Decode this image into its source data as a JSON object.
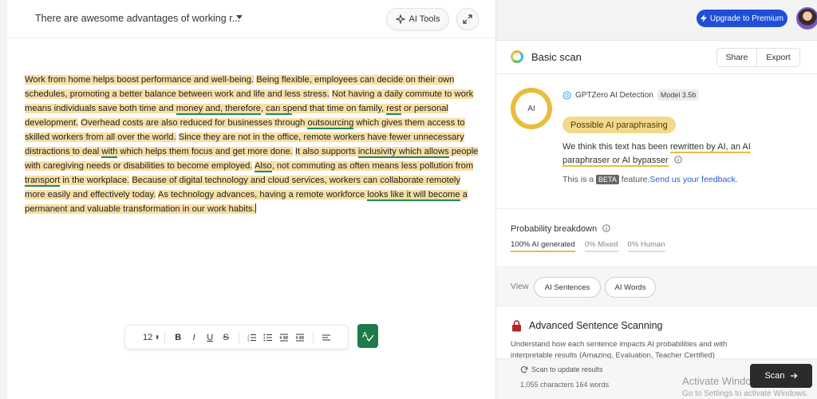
{
  "editor": {
    "doc_title": "There are awesome advantages of working r...",
    "ai_tools_label": "AI Tools",
    "paragraph": [
      {
        "t": "Work from home helps boost performance and well-being.",
        "hl": true
      },
      {
        "t": " ",
        "hl": false
      },
      {
        "t": "Being flexible, employees can decide on their own schedules, promoting a better balance between work and life and less stress.",
        "hl": true
      },
      {
        "t": " ",
        "hl": false
      },
      {
        "t": "Not having a daily commute to work means individuals save both time and ",
        "hl": true
      },
      {
        "t": "money and, therefore",
        "hl": true,
        "ul": true
      },
      {
        "t": ", ",
        "hl": true
      },
      {
        "t": "can sp",
        "hl": true,
        "ul": true
      },
      {
        "t": "end that time on family, ",
        "hl": true
      },
      {
        "t": "rest",
        "hl": true,
        "ul": true
      },
      {
        "t": " or personal development.",
        "hl": true
      },
      {
        "t": " ",
        "hl": false
      },
      {
        "t": "Overhead costs are also reduced for businesses through ",
        "hl": true
      },
      {
        "t": "outsourcing",
        "hl": true,
        "ul": true
      },
      {
        "t": " which gives them access to skilled workers from all over the world.",
        "hl": true
      },
      {
        "t": " ",
        "hl": false
      },
      {
        "t": "Since they are not in the office, remote workers have fewer unnecessary distractions to deal ",
        "hl": true
      },
      {
        "t": "with",
        "hl": true,
        "ul": true
      },
      {
        "t": " which helps them focus and get more done.",
        "hl": true
      },
      {
        "t": " ",
        "hl": false
      },
      {
        "t": "It also supports ",
        "hl": true
      },
      {
        "t": "inclusivity which allows",
        "hl": true,
        "ul": true
      },
      {
        "t": " people with caregiving needs or disabilities to become employed.",
        "hl": true
      },
      {
        "t": " ",
        "hl": false
      },
      {
        "t": "Also",
        "hl": true,
        "ul": true
      },
      {
        "t": ", not commuting as often means less pollution from ",
        "hl": true
      },
      {
        "t": "transport",
        "hl": true,
        "ul": true
      },
      {
        "t": " in the workplace.",
        "hl": true
      },
      {
        "t": " ",
        "hl": false
      },
      {
        "t": "Because of digital technology and cloud services, workers can collaborate remotely more easily and effectively today.",
        "hl": true
      },
      {
        "t": " ",
        "hl": false
      },
      {
        "t": "As technology advances, having a remote workforce ",
        "hl": true
      },
      {
        "t": "looks like it will become",
        "hl": true,
        "ul": true
      },
      {
        "t": " a permanent and valuable transformation in our work habits.",
        "hl": true
      }
    ],
    "toolbar": {
      "font_size": "12",
      "bold": "B",
      "italic": "I",
      "underline": "U",
      "strike": "S"
    }
  },
  "header": {
    "premium_label": "Upgrade to Premium"
  },
  "scan": {
    "title": "Basic scan",
    "share_label": "Share",
    "export_label": "Export",
    "ring_label": "AI",
    "detector": "GPTZero AI Detection",
    "model": "Model 3.5b",
    "verdict": "Possible AI paraphrasing",
    "explain_prefix": "We think this text has been ",
    "explain_highlight": "rewritten by AI, an AI paraphraser or AI bypasser",
    "beta_prefix": "This is a ",
    "beta_badge": "BETA",
    "beta_suffix": " feature.",
    "feedback_link": "Send us your feedback.",
    "prob_title": "Probability breakdown",
    "prob_tabs": [
      "100% AI generated",
      "0% Mixed",
      "0% Human"
    ],
    "view_label": "View",
    "view_sentences": "AI Sentences",
    "view_words": "AI Words",
    "adv_title": "Advanced Sentence Scanning",
    "adv_text": "Understand how each sentence impacts AI probabilities and with interpretable results (Amazing, Evaluation, Teacher Certified)",
    "rescan_label": "Scan to update results",
    "stats": "1,055 characters 164 words",
    "scan_label": "Scan"
  },
  "os": {
    "watermark_title": "Activate Windows",
    "watermark_sub": "Go to Settings to activate Windows."
  },
  "colors": {
    "highlight": "#f7dfa5",
    "accent_yellow": "#e9bd3c",
    "grammar_green": "#1f7a4c",
    "premium_blue": "#1f4ed8",
    "link_blue": "#2b5bd7"
  }
}
